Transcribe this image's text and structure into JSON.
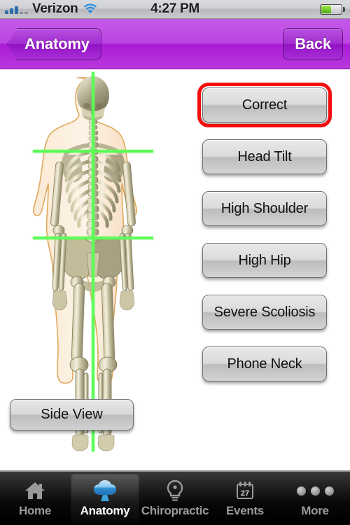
{
  "status_bar": {
    "carrier": "Verizon",
    "time": "4:27 PM",
    "signal_bars_filled": 3,
    "signal_bars_total": 5,
    "wifi_icon": "wifi-icon",
    "battery_percent": 50,
    "battery_color": "#6fc41a"
  },
  "nav_bar": {
    "back_title": "Anatomy",
    "right_button": "Back",
    "background_color": "#b938dd"
  },
  "anatomy": {
    "figure_name": "front-view-skeleton",
    "guide_line_color": "#5dfc58",
    "guides": [
      {
        "name": "vertical-plumb-line",
        "orientation": "vertical"
      },
      {
        "name": "shoulder-level-line",
        "orientation": "horizontal"
      },
      {
        "name": "hip-level-line",
        "orientation": "horizontal"
      }
    ],
    "side_view_button": "Side View"
  },
  "options": {
    "selected_index": 0,
    "selection_color": "#f50d0d",
    "items": [
      {
        "label": "Correct"
      },
      {
        "label": "Head Tilt"
      },
      {
        "label": "High Shoulder"
      },
      {
        "label": "High Hip"
      },
      {
        "label": "Severe Scoliosis"
      },
      {
        "label": "Phone Neck"
      }
    ]
  },
  "tab_bar": {
    "active_index": 1,
    "items": [
      {
        "label": "Home",
        "icon": "home-icon"
      },
      {
        "label": "Anatomy",
        "icon": "tree-icon"
      },
      {
        "label": "Chiropractic",
        "icon": "lightbulb-icon"
      },
      {
        "label": "Events",
        "icon": "calendar-icon",
        "calendar_day": "27"
      },
      {
        "label": "More",
        "icon": "more-dots-icon"
      }
    ]
  }
}
